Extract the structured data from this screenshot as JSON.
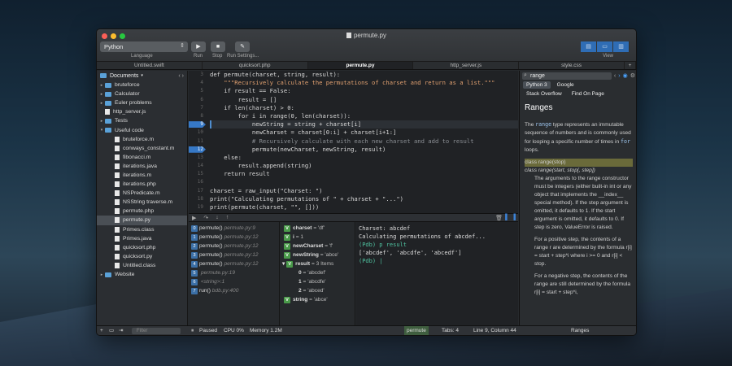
{
  "window": {
    "title": "permute.py"
  },
  "toolbar": {
    "language_value": "Python",
    "language_caption": "Language",
    "run_label": "Run",
    "stop_label": "Stop",
    "run_settings_label": "Run Settings...",
    "view_label": "View"
  },
  "tabs": [
    {
      "label": "Untitled.swift"
    },
    {
      "label": "quicksort.php"
    },
    {
      "label": "permute.py"
    },
    {
      "label": "http_server.js"
    },
    {
      "label": "style.css"
    },
    {
      "label": "+"
    }
  ],
  "sidebar": {
    "header": "Documents",
    "items": [
      {
        "label": "bruteforce",
        "type": "folder",
        "indent": 0
      },
      {
        "label": "Calculator",
        "type": "folder",
        "indent": 0
      },
      {
        "label": "Euler problems",
        "type": "folder",
        "indent": 0
      },
      {
        "label": "http_server.js",
        "type": "file",
        "indent": 0
      },
      {
        "label": "Tests",
        "type": "folder",
        "indent": 0
      },
      {
        "label": "Useful code",
        "type": "folder",
        "indent": 0
      },
      {
        "label": "bruteforce.m",
        "type": "file",
        "indent": 1
      },
      {
        "label": "conways_constant.m",
        "type": "file",
        "indent": 1
      },
      {
        "label": "fibonacci.m",
        "type": "file",
        "indent": 1
      },
      {
        "label": "iterations.java",
        "type": "file",
        "indent": 1
      },
      {
        "label": "iterations.m",
        "type": "file",
        "indent": 1
      },
      {
        "label": "iterations.php",
        "type": "file",
        "indent": 1
      },
      {
        "label": "NSPredicate.m",
        "type": "file",
        "indent": 1
      },
      {
        "label": "NSString traverse.m",
        "type": "file",
        "indent": 1
      },
      {
        "label": "permute.php",
        "type": "file",
        "indent": 1
      },
      {
        "label": "permute.py",
        "type": "file",
        "indent": 1,
        "selected": true
      },
      {
        "label": "Primes.class",
        "type": "file",
        "indent": 1
      },
      {
        "label": "Primes.java",
        "type": "file",
        "indent": 1
      },
      {
        "label": "quicksort.php",
        "type": "file",
        "indent": 1
      },
      {
        "label": "quicksort.py",
        "type": "file",
        "indent": 1
      },
      {
        "label": "Untitled.class",
        "type": "file",
        "indent": 1
      },
      {
        "label": "Website",
        "type": "folder",
        "indent": 0
      }
    ]
  },
  "editor": {
    "lines": [
      {
        "n": "3",
        "text": "def permute(charset, string, result):"
      },
      {
        "n": "4",
        "text": "    \"\"\"Recursively calculate the permutations of charset and return as a list.\"\"\""
      },
      {
        "n": "5",
        "text": "    if result == False:"
      },
      {
        "n": "6",
        "text": "        result = []"
      },
      {
        "n": "7",
        "text": "    if len(charset) > 0:"
      },
      {
        "n": "8",
        "text": "        for i in range(0, len(charset)):"
      },
      {
        "n": "9",
        "text": "            newString = string + charset[i]"
      },
      {
        "n": "10",
        "text": "            newCharset = charset[0:i] + charset[i+1:]"
      },
      {
        "n": "11",
        "text": "            # Recursively calculate with each new charset and add to result"
      },
      {
        "n": "12",
        "text": "            permute(newCharset, newString, result)"
      },
      {
        "n": "13",
        "text": "    else:"
      },
      {
        "n": "14",
        "text": "        result.append(string)"
      },
      {
        "n": "15",
        "text": "    return result"
      },
      {
        "n": "16",
        "text": ""
      },
      {
        "n": "17",
        "text": "charset = raw_input(\"Charset: \")"
      },
      {
        "n": "18",
        "text": "print(\"Calculating permutations of \" + charset + \"...\")"
      },
      {
        "n": "19",
        "text": "print(permute(charset, \"\", []))"
      }
    ]
  },
  "stack": [
    {
      "idx": "0",
      "fn": "permute()",
      "loc": "permute.py:9"
    },
    {
      "idx": "1",
      "fn": "permute()",
      "loc": "permute.py:12"
    },
    {
      "idx": "2",
      "fn": "permute()",
      "loc": "permute.py:12"
    },
    {
      "idx": "3",
      "fn": "permute()",
      "loc": "permute.py:12"
    },
    {
      "idx": "4",
      "fn": "permute()",
      "loc": "permute.py:12"
    },
    {
      "idx": "5",
      "fn": "",
      "loc": "permute.py:19"
    },
    {
      "idx": "6",
      "fn": "",
      "loc": "<string>:1"
    },
    {
      "idx": "7",
      "fn": "run()",
      "loc": "bdb.py:400"
    }
  ],
  "variables": [
    {
      "name": "charset",
      "value": "= 'df'",
      "badge": "V"
    },
    {
      "name": "i",
      "value": "= 1",
      "badge": "V"
    },
    {
      "name": "newCharset",
      "value": "= 'f'",
      "badge": "V"
    },
    {
      "name": "newString",
      "value": "= 'abce'",
      "badge": "V"
    },
    {
      "name": "result",
      "value": "= 3 Items",
      "badge": "V"
    },
    {
      "name": "0",
      "value": "= 'abcdef'",
      "badge": ""
    },
    {
      "name": "1",
      "value": "= 'abcdfe'",
      "badge": ""
    },
    {
      "name": "2",
      "value": "= 'abced'",
      "badge": ""
    },
    {
      "name": "string",
      "value": "= 'abce'",
      "badge": "V"
    }
  ],
  "console": [
    {
      "text": "Charset: abcdef",
      "kind": "out"
    },
    {
      "text": "Calculating permutations of abcdef...",
      "kind": "out"
    },
    {
      "text": "(Pdb) p result",
      "kind": "pdb"
    },
    {
      "text": "['abcdef', 'abcdfe', 'abcedf']",
      "kind": "out"
    },
    {
      "text": "(Pdb) |",
      "kind": "pdb"
    }
  ],
  "help": {
    "search_value": "range",
    "chips": [
      "Python 3",
      "Google",
      "Stack Overflow",
      "Find On Page"
    ],
    "title": "Ranges",
    "intro_pre": "The ",
    "intro_code": "range",
    "intro_post": " type represents an immutable sequence of numbers and is commonly used for looping a specific number of times in ",
    "intro_code2": "for",
    "intro_end": " loops.",
    "sig1": "class range(stop)",
    "sig2": "class range(start, stop[, step])",
    "p1": "The arguments to the range constructor must be integers (either built-in int or any object that implements the __index__ special method). If the step argument is omitted, it defaults to 1. If the start argument is omitted, it defaults to 0. If step is zero, ValueError is raised.",
    "p2": "For a positive step, the contents of a range r are determined by the formula r[i] = start + step*i where i >= 0 and r[i] < stop.",
    "p3": "For a negative step, the contents of the range are still determined by the formula r[i] = start + step*i,"
  },
  "status": {
    "filter_placeholder": "Filter",
    "state": "Paused",
    "cpu": "CPU 0%",
    "memory": "Memory 1.2M",
    "target": "permute",
    "tabs": "Tabs: 4",
    "position": "Line 9, Column 44",
    "symbol": "Ranges"
  },
  "colors": {
    "accent": "#3678c6",
    "pdb": "#4fc19f",
    "keyword": "#f08a6e"
  }
}
